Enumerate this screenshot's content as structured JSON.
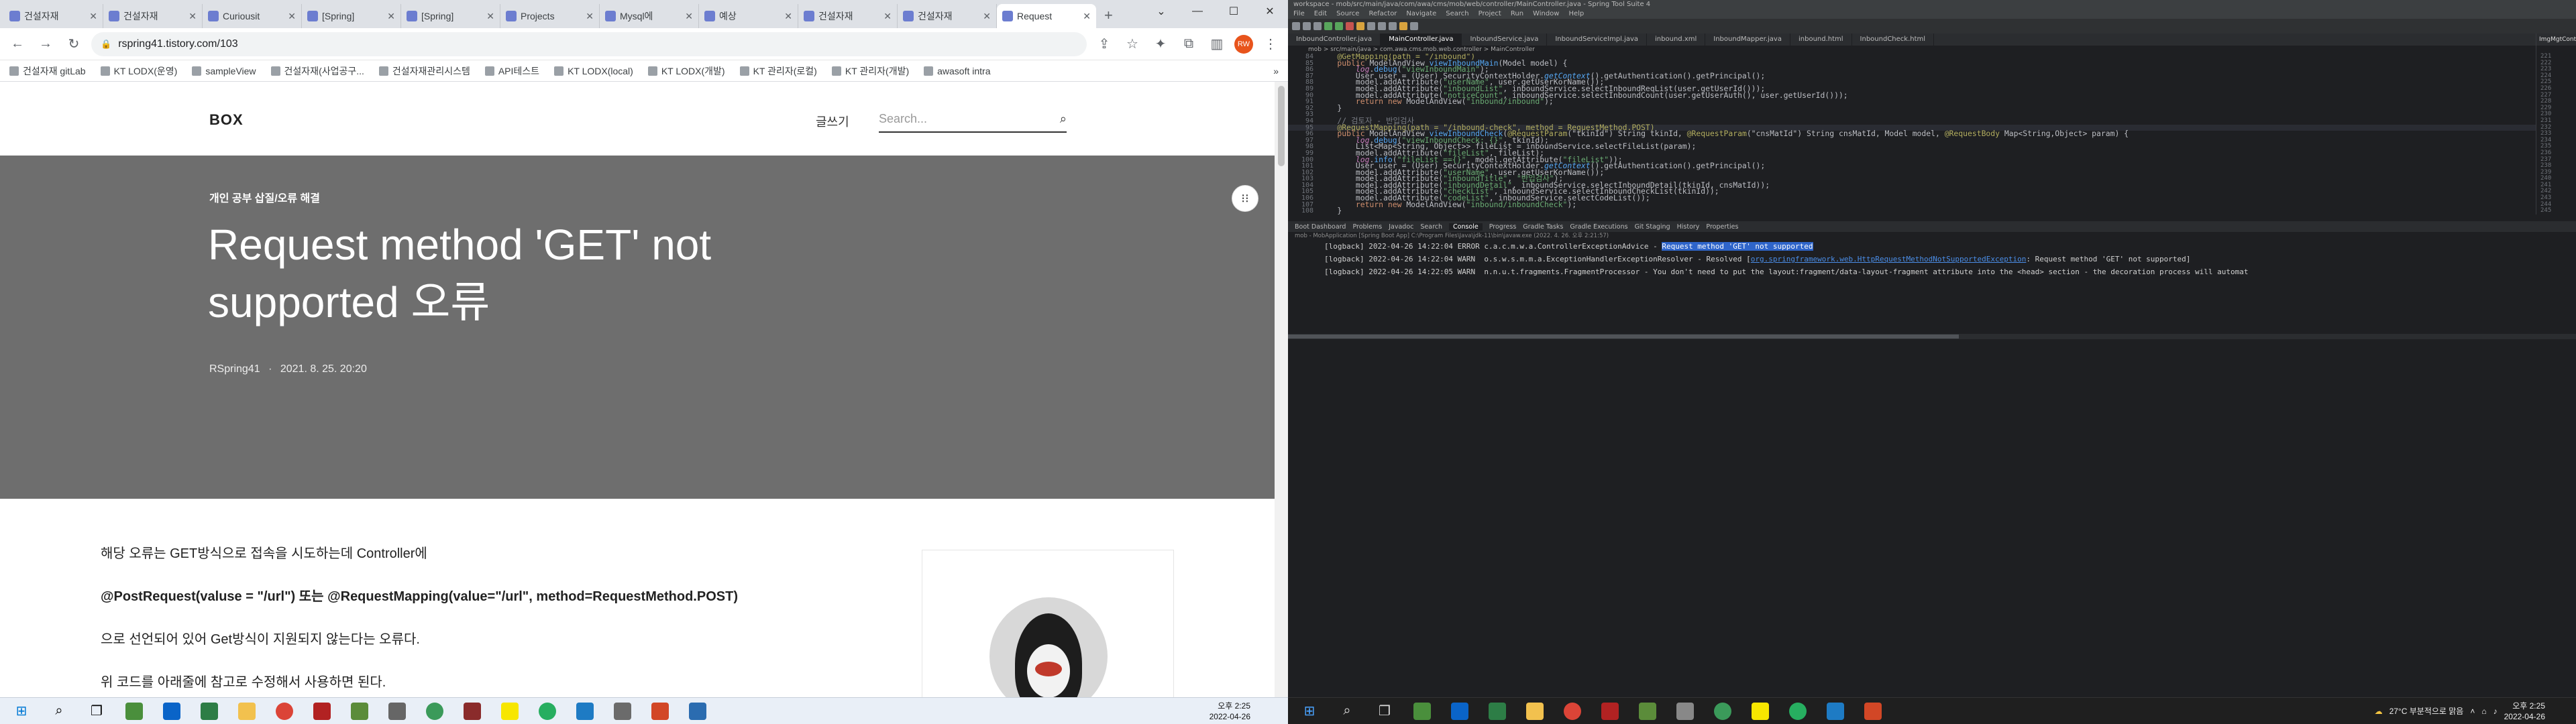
{
  "browser": {
    "tabs": [
      {
        "label": "건설자재"
      },
      {
        "label": "건설자재"
      },
      {
        "label": "Curiousit"
      },
      {
        "label": "[Spring]"
      },
      {
        "label": "[Spring]"
      },
      {
        "label": "Projects"
      },
      {
        "label": "Mysql에"
      },
      {
        "label": "예상"
      },
      {
        "label": "건설자재"
      },
      {
        "label": "건설자재"
      },
      {
        "label": "Request"
      }
    ],
    "new_tab": "+",
    "url": "rspring41.tistory.com/103",
    "avatar_text": "RW",
    "bookmarks": [
      {
        "label": "건설자재 gitLab"
      },
      {
        "label": "KT LODX(운영)"
      },
      {
        "label": "sampleView"
      },
      {
        "label": "건설자재(사업공구..."
      },
      {
        "label": "건설자재관리시스템"
      },
      {
        "label": "API테스트"
      },
      {
        "label": "KT LODX(local)"
      },
      {
        "label": "KT LODX(개발)"
      },
      {
        "label": "KT 관리자(로컬)"
      },
      {
        "label": "KT 관리자(개발)"
      },
      {
        "label": "awasoft intra"
      }
    ],
    "bookmarks_more": "»"
  },
  "blog": {
    "logo": "BOX",
    "write": "글쓰기",
    "search_placeholder": "Search...",
    "category": "개인 공부 삽질/오류 해결",
    "title": "Request method 'GET' not supported 오류",
    "author": "RSpring41",
    "date": "2021. 8. 25. 20:20",
    "meta_sep": "·",
    "paragraphs": [
      "해당 오류는 GET방식으로 접속을 시도하는데 Controller에",
      "@PostRequest(valuse = \"/url\") 또는 @RequestMapping(value=\"/url\", method=RequestMethod.POST)",
      "으로 선언되어 있어 Get방식이 지원되지 않는다는 오류다.",
      "위 코드를 아래줄에 참고로 수정해서 사용하면 된다."
    ]
  },
  "left_taskbar": {
    "time": "오후 2:25",
    "date": "2022-04-26"
  },
  "ide": {
    "title": "workspace - mob/src/main/java/com/awa/cms/mob/web/controller/MainController.java - Spring Tool Suite 4",
    "menu": [
      "File",
      "Edit",
      "Source",
      "Refactor",
      "Navigate",
      "Search",
      "Project",
      "Run",
      "Window",
      "Help"
    ],
    "editor_tabs": [
      "InboundController.java",
      "MainController.java",
      "InboundService.java",
      "InboundServiceImpl.java",
      "inbound.xml",
      "InboundMapper.java",
      "inbound.html",
      "InboundCheck.html"
    ],
    "active_tab_index": 1,
    "right_tab": "ImgMgtCont...",
    "breadcrumb": "mob > src/main/java > com.awa.cms.mob.web.controller > MainController",
    "code_lines": [
      {
        "n": "84",
        "segs": [
          {
            "c": "ann",
            "t": "    @GetMapping(path = \"/inbound\")"
          }
        ]
      },
      {
        "n": "85",
        "segs": [
          {
            "c": "kw",
            "t": "    public "
          },
          {
            "c": "ct",
            "t": "ModelAndView "
          },
          {
            "c": "mth",
            "t": "viewInboundMain"
          },
          {
            "c": "ct",
            "t": "(Model model) {"
          }
        ]
      },
      {
        "n": "86",
        "segs": [
          {
            "c": "fld it",
            "t": "        log"
          },
          {
            "c": "ct",
            "t": "."
          },
          {
            "c": "mth",
            "t": "debug"
          },
          {
            "c": "ct",
            "t": "("
          },
          {
            "c": "str",
            "t": "\"viewInboundMain\""
          },
          {
            "c": "ct",
            "t": ");"
          }
        ]
      },
      {
        "n": "87",
        "segs": [
          {
            "c": "ct",
            "t": "        User user = (User) SecurityContextHolder."
          },
          {
            "c": "mth it",
            "t": "getContext"
          },
          {
            "c": "ct",
            "t": "().getAuthentication().getPrincipal();"
          }
        ]
      },
      {
        "n": "88",
        "segs": [
          {
            "c": "ct",
            "t": "        model.addAttribute("
          },
          {
            "c": "str",
            "t": "\"userName\""
          },
          {
            "c": "ct",
            "t": ", user.getUserKorName());"
          }
        ]
      },
      {
        "n": "89",
        "segs": [
          {
            "c": "ct",
            "t": "        model.addAttribute("
          },
          {
            "c": "str",
            "t": "\"inboundList\""
          },
          {
            "c": "ct",
            "t": ", inboundService.selectInboundReqList(user.getUserId()));"
          }
        ]
      },
      {
        "n": "90",
        "segs": [
          {
            "c": "ct",
            "t": "        model.addAttribute("
          },
          {
            "c": "str",
            "t": "\"noticeCount\""
          },
          {
            "c": "ct",
            "t": ", inboundService.selectInboundCount(user.getUserAuth(), user.getUserId()));"
          }
        ]
      },
      {
        "n": "91",
        "segs": [
          {
            "c": "kw",
            "t": "        return new "
          },
          {
            "c": "ct",
            "t": "ModelAndView("
          },
          {
            "c": "str",
            "t": "\"inbound/inbound\""
          },
          {
            "c": "ct",
            "t": ");"
          }
        ]
      },
      {
        "n": "92",
        "segs": [
          {
            "c": "ct",
            "t": "    }"
          }
        ]
      },
      {
        "n": "93",
        "segs": [
          {
            "c": "ct",
            "t": ""
          }
        ]
      },
      {
        "n": "94",
        "segs": [
          {
            "c": "cmt",
            "t": "    // 검토자 - 반입검사"
          }
        ]
      },
      {
        "n": "95",
        "segs": [
          {
            "c": "ann",
            "t": "    @RequestMapping(path = \"/inbound-check\", method = RequestMethod.POST)"
          }
        ]
      },
      {
        "n": "96",
        "segs": [
          {
            "c": "kw",
            "t": "    public "
          },
          {
            "c": "ct",
            "t": "ModelAndView "
          },
          {
            "c": "mth",
            "t": "viewInboundCheck"
          },
          {
            "c": "ct",
            "t": "("
          },
          {
            "c": "ann",
            "t": "@RequestParam"
          },
          {
            "c": "ct",
            "t": "(\"tkinId\") String tkinId, "
          },
          {
            "c": "ann",
            "t": "@RequestParam"
          },
          {
            "c": "ct",
            "t": "(\"cnsMatId\") String cnsMatId, Model model, "
          },
          {
            "c": "ann",
            "t": "@RequestBody"
          },
          {
            "c": "ct",
            "t": " Map<String,Object> param) {"
          }
        ]
      },
      {
        "n": "97",
        "segs": [
          {
            "c": "fld it",
            "t": "        log"
          },
          {
            "c": "ct",
            "t": "."
          },
          {
            "c": "mth",
            "t": "debug"
          },
          {
            "c": "ct",
            "t": "("
          },
          {
            "c": "str",
            "t": "\"viewInboundCheck: {}\""
          },
          {
            "c": "ct",
            "t": ", tkinId);"
          }
        ]
      },
      {
        "n": "98",
        "segs": [
          {
            "c": "ct",
            "t": "        List<Map<String, Object>> fileList = inboundService.selectFileList(param);"
          }
        ]
      },
      {
        "n": "99",
        "segs": [
          {
            "c": "ct",
            "t": "        model.addAttribute("
          },
          {
            "c": "str",
            "t": "\"fileList\""
          },
          {
            "c": "ct",
            "t": ", fileList);"
          }
        ]
      },
      {
        "n": "100",
        "segs": [
          {
            "c": "fld it",
            "t": "        log"
          },
          {
            "c": "ct",
            "t": "."
          },
          {
            "c": "mth",
            "t": "info"
          },
          {
            "c": "ct",
            "t": "("
          },
          {
            "c": "str",
            "t": "\"fileList =={}\""
          },
          {
            "c": "ct",
            "t": ", model.getAttribute("
          },
          {
            "c": "str",
            "t": "\"fileList\""
          },
          {
            "c": "ct",
            "t": "));"
          }
        ]
      },
      {
        "n": "101",
        "segs": [
          {
            "c": "ct",
            "t": "        User user = (User) SecurityContextHolder."
          },
          {
            "c": "mth it",
            "t": "getContext"
          },
          {
            "c": "ct",
            "t": "().getAuthentication().getPrincipal();"
          }
        ]
      },
      {
        "n": "102",
        "segs": [
          {
            "c": "ct",
            "t": "        model.addAttribute("
          },
          {
            "c": "str",
            "t": "\"userName\""
          },
          {
            "c": "ct",
            "t": ", user.getUserKorName());"
          }
        ]
      },
      {
        "n": "103",
        "segs": [
          {
            "c": "ct",
            "t": "        model.addAttribute("
          },
          {
            "c": "str",
            "t": "\"inboundTitle\""
          },
          {
            "c": "ct",
            "t": ", "
          },
          {
            "c": "str",
            "t": "\"반입검사\""
          },
          {
            "c": "ct",
            "t": ");"
          }
        ]
      },
      {
        "n": "104",
        "segs": [
          {
            "c": "ct",
            "t": "        model.addAttribute("
          },
          {
            "c": "str",
            "t": "\"inboundDetail\""
          },
          {
            "c": "ct",
            "t": ", inboundService.selectInboundDetail(tkinId, cnsMatId));"
          }
        ]
      },
      {
        "n": "105",
        "segs": [
          {
            "c": "ct",
            "t": "        model.addAttribute("
          },
          {
            "c": "str",
            "t": "\"checkList\""
          },
          {
            "c": "ct",
            "t": ", inboundService.selectInboundCheckList(tkinId));"
          }
        ]
      },
      {
        "n": "106",
        "segs": [
          {
            "c": "ct",
            "t": "        model.addAttribute("
          },
          {
            "c": "str",
            "t": "\"codeList\""
          },
          {
            "c": "ct",
            "t": ", inboundService.selectCodeList());"
          }
        ]
      },
      {
        "n": "107",
        "segs": [
          {
            "c": "kw",
            "t": "        return new "
          },
          {
            "c": "ct",
            "t": "ModelAndView("
          },
          {
            "c": "str",
            "t": "\"inbound/inboundCheck\""
          },
          {
            "c": "ct",
            "t": ");"
          }
        ]
      },
      {
        "n": "108",
        "segs": [
          {
            "c": "ct",
            "t": "    }"
          }
        ]
      }
    ],
    "right_line_numbers": [
      "221",
      "222",
      "223",
      "224",
      "225",
      "226",
      "227",
      "228",
      "229",
      "230",
      "231",
      "232",
      "233",
      "234",
      "235",
      "236",
      "237",
      "238",
      "239",
      "240",
      "241",
      "242",
      "243",
      "244",
      "245"
    ],
    "panel_tabs": [
      "Boot Dashboard",
      "Problems",
      "Javadoc",
      "Search",
      "Console",
      "Progress",
      "Gradle Tasks",
      "Gradle Executions",
      "Git Staging",
      "History",
      "Properties"
    ],
    "active_panel_index": 4,
    "console_path": "mob - MobApplication [Spring Boot App] C:\\Program Files\\Java\\jdk-11\\bin\\javaw.exe (2022. 4. 26. 오후 2:21:57)",
    "console_lines": [
      {
        "pre": "[logback] 2022-04-26 14:22:04 ERROR c.a.c.m.w.a.ControllerExceptionAdvice - ",
        "hl": "Request method 'GET' not supported",
        "link": "",
        "post": ""
      },
      {
        "pre": "[logback] 2022-04-26 14:22:04 WARN  o.s.w.s.m.m.a.ExceptionHandlerExceptionResolver - Resolved [",
        "hl": "",
        "link": "org.springframework.web.HttpRequestMethodNotSupportedException",
        "post": ": Request method 'GET' not supported]"
      },
      {
        "pre": "[logback] 2022-04-26 14:22:05 WARN  n.n.u.t.fragments.FragmentProcessor - You don't need to put the layout:fragment/data-layout-fragment attribute into the <head> section - the decoration process will automat",
        "hl": "",
        "link": "",
        "post": ""
      }
    ]
  },
  "right_taskbar": {
    "weather": "27°C 부분적으로 맑음",
    "time": "오후 2:25",
    "date": "2022-04-26"
  },
  "colors": {
    "hero_bg": "#6e6e6e",
    "chrome_tab_strip": "#dee1e6",
    "ide_bg": "#1e1f22",
    "console_highlight": "#2f65ca"
  }
}
